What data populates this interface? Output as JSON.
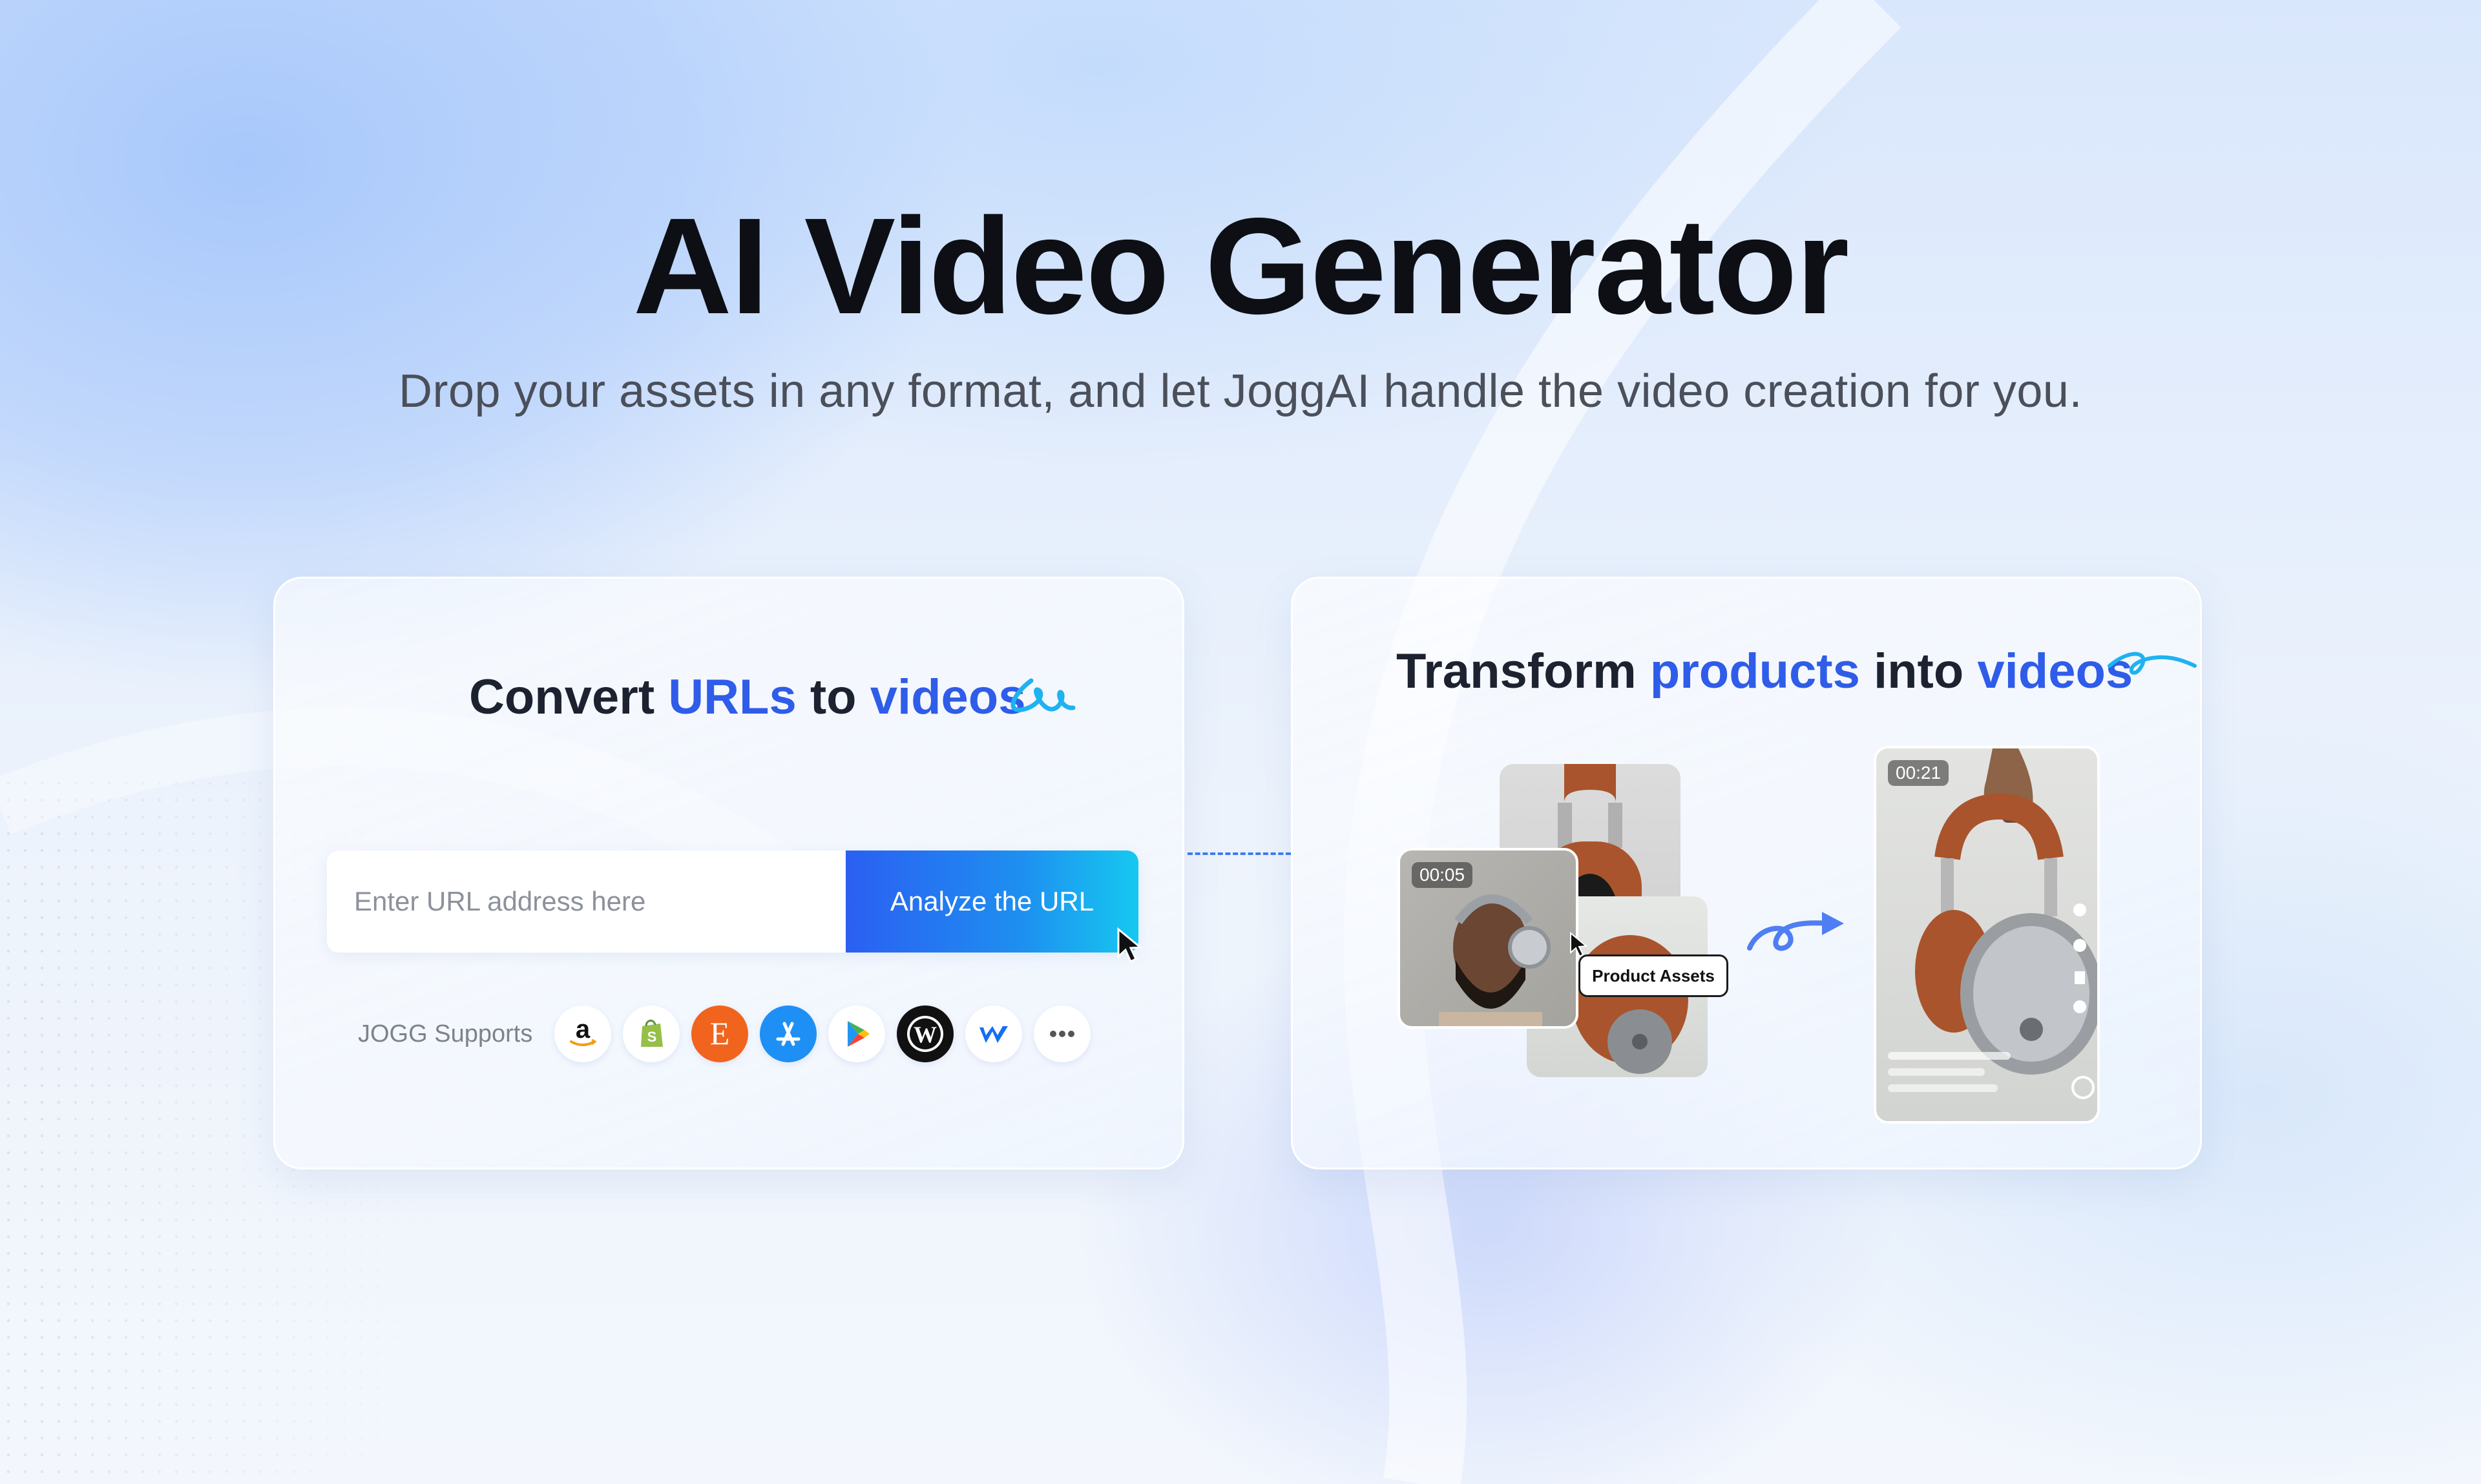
{
  "hero": {
    "title": "AI Video Generator",
    "subtitle": "Drop your assets in any format, and let JoggAI handle the video creation for you."
  },
  "url_card": {
    "title_parts": {
      "a": "Convert ",
      "b": "URLs",
      "c": " to ",
      "d": "videos"
    },
    "input_placeholder": "Enter URL address here",
    "button_label": "Analyze the URL",
    "supports_label": "JOGG Supports",
    "platform_icons": [
      "amazon-icon",
      "shopify-icon",
      "etsy-icon",
      "app-store-icon",
      "google-play-icon",
      "wordpress-icon",
      "webflow-icon",
      "more-icon"
    ]
  },
  "product_card": {
    "title_parts": {
      "a": "Transform ",
      "b": "products",
      "c": " into ",
      "d": "videos"
    },
    "input_clip_time": "00:05",
    "output_clip_time": "00:21",
    "tooltip_label": "Product Assets"
  },
  "colors": {
    "accent_blue": "#2f5ce8",
    "button_gradient_start": "#2b5ff2",
    "button_gradient_end": "#16c8f0",
    "headphone_leather": "#a9542c"
  }
}
